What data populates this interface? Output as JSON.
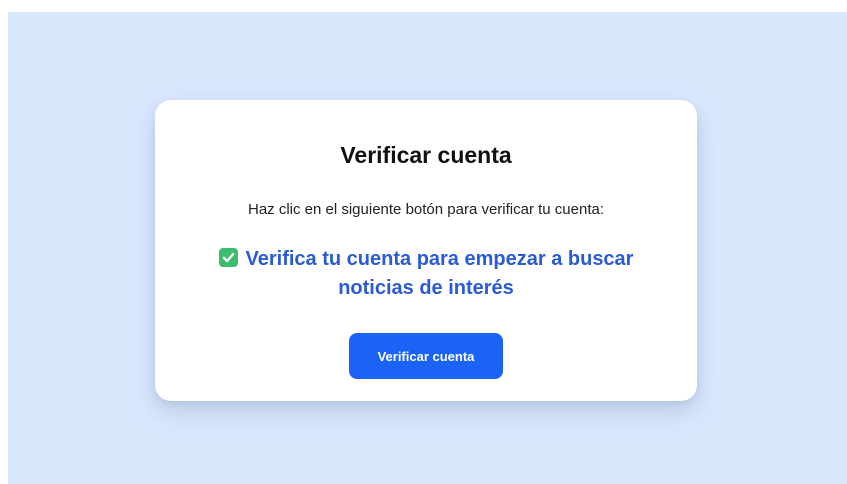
{
  "card": {
    "title": "Verificar cuenta",
    "instruction": "Haz clic en el siguiente botón para verificar tu cuenta:",
    "highlight_line1": "Verifica tu cuenta para empezar a buscar",
    "highlight_line2": "noticias de interés",
    "highlight_icon": "check-mark-icon",
    "button_label": "Verificar cuenta"
  },
  "colors": {
    "page_background": "#dae8fe",
    "card_background": "#ffffff",
    "highlight_text": "#2a5bd7",
    "check_icon": "#3dbb6e",
    "button_background": "#1b63f5",
    "button_text": "#ffffff"
  }
}
